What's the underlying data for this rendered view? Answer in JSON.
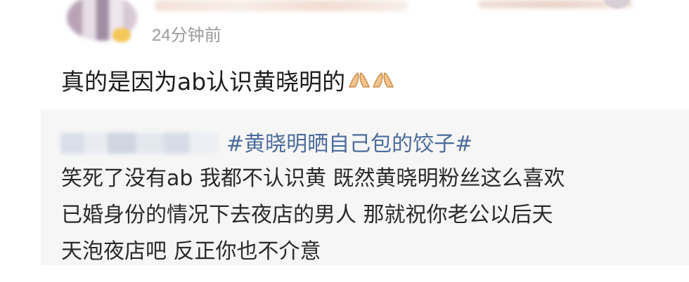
{
  "post": {
    "timestamp": "24分钟前",
    "comment": "真的是因为ab认识黄晓明的",
    "emojis": [
      "hands-together-emoji",
      "hands-together-emoji"
    ]
  },
  "quote": {
    "hashtag": "#黄晓明晒自己包的饺子#",
    "lines": [
      "笑死了没有ab 我都不认识黄 既然黄晓明粉丝这么喜欢",
      "已婚身份的情况下去夜店的男人 那就祝你老公以后天",
      "天泡夜店吧 反正你也不介意"
    ]
  },
  "colors": {
    "timestamp": "#9b9b9b",
    "hashtag": "#4b6c9c",
    "quote_bg": "#f6f6f6",
    "text": "#1d1d1d"
  }
}
